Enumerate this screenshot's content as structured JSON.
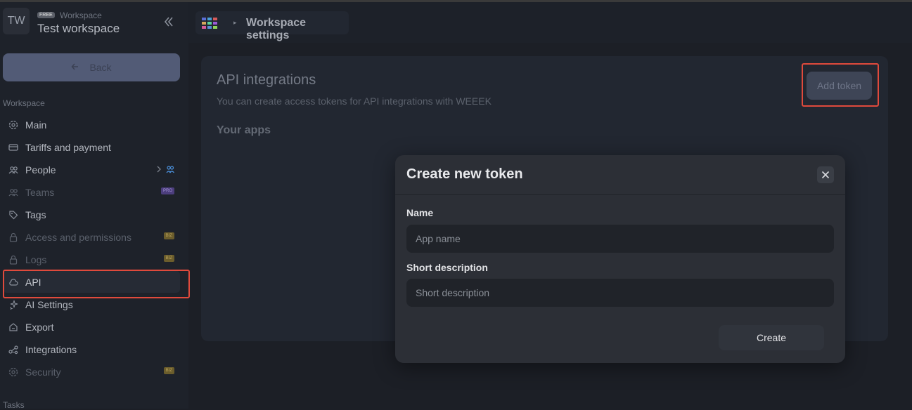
{
  "workspace": {
    "initials": "TW",
    "plan_badge": "FREE",
    "label": "Workspace",
    "name": "Test workspace"
  },
  "sidebar": {
    "back_label": "Back",
    "section_workspace": "Workspace",
    "items": [
      {
        "label": "Main",
        "icon": "gear-icon"
      },
      {
        "label": "Tariffs and payment",
        "icon": "card-icon"
      },
      {
        "label": "People",
        "icon": "people-icon"
      },
      {
        "label": "Teams",
        "icon": "team-icon",
        "badge": "PRO"
      },
      {
        "label": "Tags",
        "icon": "tag-icon"
      },
      {
        "label": "Access and permissions",
        "icon": "lock-icon",
        "badge": "BIZ"
      },
      {
        "label": "Logs",
        "icon": "lock-icon",
        "badge": "BIZ"
      },
      {
        "label": "API",
        "icon": "cloud-icon"
      },
      {
        "label": "AI Settings",
        "icon": "sparkle-icon"
      },
      {
        "label": "Export",
        "icon": "export-icon"
      },
      {
        "label": "Integrations",
        "icon": "integrations-icon"
      },
      {
        "label": "Security",
        "icon": "gear-icon",
        "badge": "BIZ"
      }
    ],
    "section_tasks": "Tasks"
  },
  "header": {
    "breadcrumb_title": "Workspace settings"
  },
  "main": {
    "title": "API integrations",
    "subtitle": "You can create access tokens for API integrations with WEEEK",
    "apps_heading": "Your apps",
    "add_token_label": "Add token"
  },
  "modal": {
    "title": "Create new token",
    "name_label": "Name",
    "name_placeholder": "App name",
    "desc_label": "Short description",
    "desc_placeholder": "Short description",
    "create_label": "Create"
  },
  "colors": {
    "highlight": "#e04a3c",
    "accent": "#525b76"
  }
}
